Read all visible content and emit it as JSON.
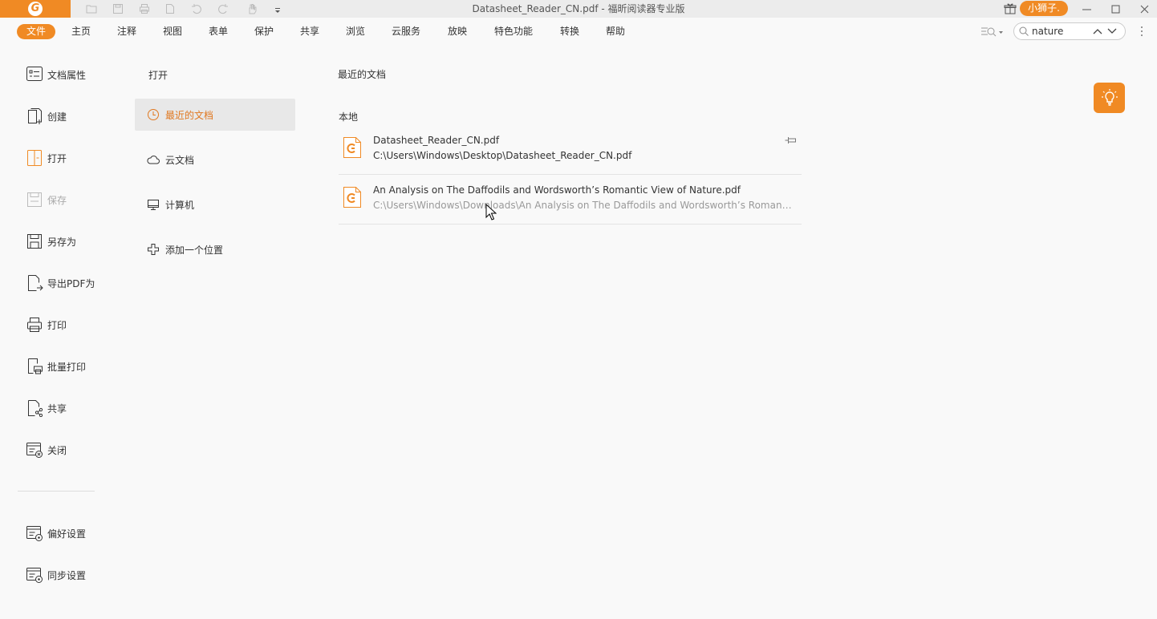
{
  "titlebar": {
    "title": "Datasheet_Reader_CN.pdf - 福昕阅读器专业版",
    "user_label": "小狮子.",
    "logo_letter": "G"
  },
  "menu": {
    "items": [
      "文件",
      "主页",
      "注释",
      "视图",
      "表单",
      "保护",
      "共享",
      "浏览",
      "云服务",
      "放映",
      "特色功能",
      "转换",
      "帮助"
    ],
    "active_index": 0
  },
  "search": {
    "value": "nature"
  },
  "left": {
    "items": [
      {
        "label": "文档属性",
        "icon": "doc-properties-icon"
      },
      {
        "label": "创建",
        "icon": "create-icon"
      },
      {
        "label": "打开",
        "icon": "open-icon"
      },
      {
        "label": "保存",
        "icon": "save-icon",
        "disabled": true
      },
      {
        "label": "另存为",
        "icon": "save-as-icon"
      },
      {
        "label": "导出PDF为",
        "icon": "export-pdf-icon"
      },
      {
        "label": "打印",
        "icon": "print-icon"
      },
      {
        "label": "批量打印",
        "icon": "batch-print-icon"
      },
      {
        "label": "共享",
        "icon": "share-icon"
      },
      {
        "label": "关闭",
        "icon": "close-doc-icon"
      }
    ],
    "bottom_items": [
      {
        "label": "偏好设置",
        "icon": "preferences-icon"
      },
      {
        "label": "同步设置",
        "icon": "sync-settings-icon"
      }
    ]
  },
  "middle": {
    "heading": "打开",
    "items": [
      {
        "label": "最近的文档",
        "icon": "clock-icon",
        "selected": true
      },
      {
        "label": "云文档",
        "icon": "cloud-icon"
      },
      {
        "label": "计算机",
        "icon": "computer-icon"
      },
      {
        "label": "添加一个位置",
        "icon": "plus-icon"
      }
    ]
  },
  "right": {
    "heading": "最近的文档",
    "section": "本地",
    "files": [
      {
        "name": "Datasheet_Reader_CN.pdf",
        "path": "C:\\Users\\Windows\\Desktop\\Datasheet_Reader_CN.pdf"
      },
      {
        "name": "An Analysis on The Daffodils and Wordsworth’s Romantic View of Nature.pdf",
        "path": "C:\\Users\\Windows\\Downloads\\An Analysis on The Daffodils and Wordsworth’s Romantic View of Nature.pdf"
      }
    ]
  },
  "colors": {
    "accent": "#f08a24",
    "selected_text": "#e07820"
  }
}
